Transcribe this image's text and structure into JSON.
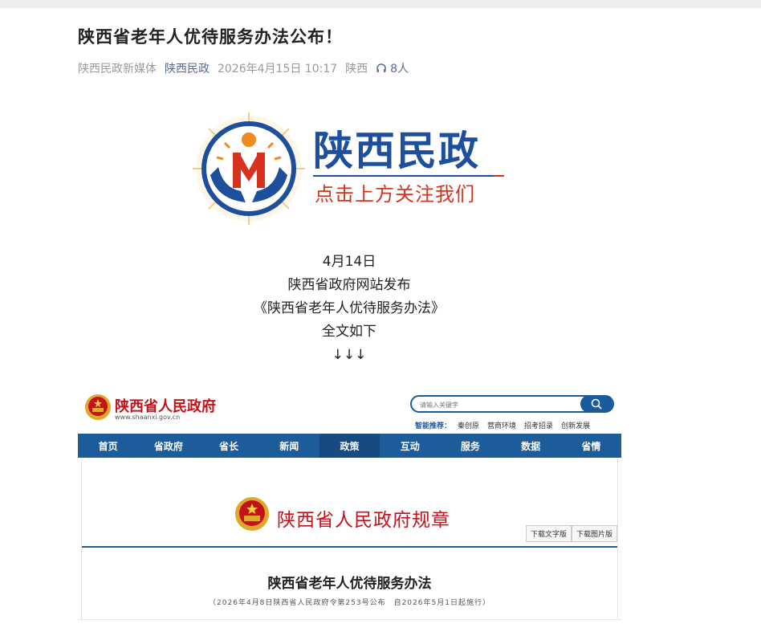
{
  "article": {
    "title": "陕西省老年人优待服务办法公布！",
    "meta": {
      "source": "陕西民政新媒体",
      "author": "陕西民政",
      "datetime": "2026年4月15日 10:17",
      "location": "陕西",
      "listeners": "8人",
      "listen_icon": "headphones-icon"
    }
  },
  "banner": {
    "brand": "陕西民政",
    "slogan": "点击上方关注我们",
    "colors": {
      "blue": "#1e4f9c",
      "red": "#d6321e",
      "orange": "#f08a1c"
    }
  },
  "intro_lines": [
    "4月14日",
    "陕西省政府网站发布",
    "《陕西省老年人优待服务办法》",
    "全文如下",
    "↓↓↓"
  ],
  "gov_site": {
    "name": "陕西省人民政府",
    "url": "www.shaanxi.gov.cn",
    "search_placeholder": "请输入关键字",
    "hot_label": "智能推荐：",
    "hot_items": [
      "秦创原",
      "营商环境",
      "招考招录",
      "创新发展"
    ],
    "nav": [
      "首页",
      "省政府",
      "省长",
      "新闻",
      "政策",
      "互动",
      "服务",
      "数据",
      "省情"
    ],
    "active_nav": "政策",
    "section_title": "陕西省人民政府规章",
    "download_text": "下载文字版",
    "download_image": "下载图片版",
    "doc_title": "陕西省老年人优待服务办法",
    "doc_subtitle": "（2026年4月8日陕西省人民政府令第253号公布　自2026年5月1日起施行）",
    "colors": {
      "nav": "#1d5c9a",
      "red": "#c4121b"
    }
  }
}
